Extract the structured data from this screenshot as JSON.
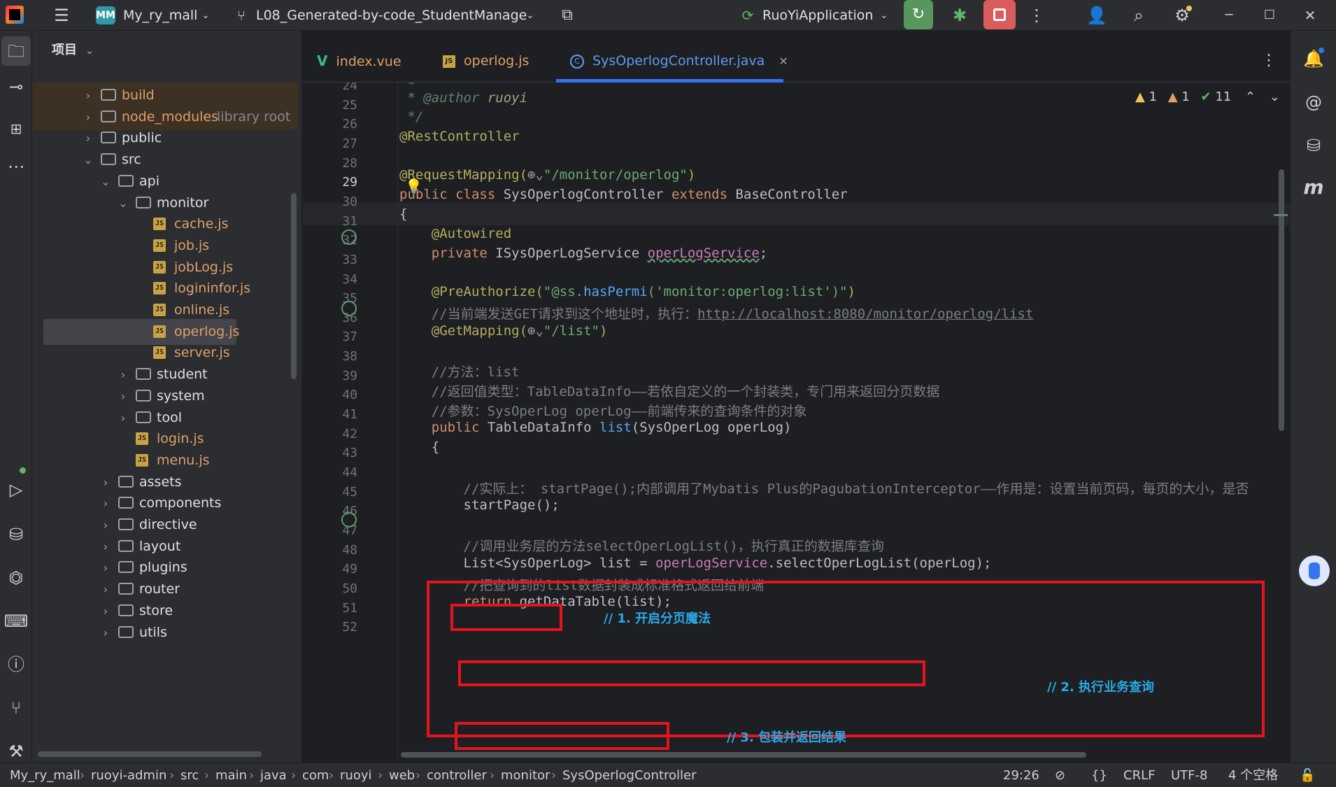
{
  "titlebar": {
    "project_badge": "MM",
    "project_name": "My_ry_mall",
    "branch_name": "L08_Generated-by-code_StudentManage",
    "run_config": "RuoYiApplication"
  },
  "project_panel": {
    "title": "项目",
    "items": [
      {
        "label": "build"
      },
      {
        "label": "node_modules",
        "hint": "library root"
      },
      {
        "label": "public"
      },
      {
        "label": "src"
      },
      {
        "label": "api"
      },
      {
        "label": "monitor"
      },
      {
        "label": "cache.js"
      },
      {
        "label": "job.js"
      },
      {
        "label": "jobLog.js"
      },
      {
        "label": "logininfor.js"
      },
      {
        "label": "online.js"
      },
      {
        "label": "operlog.js"
      },
      {
        "label": "server.js"
      },
      {
        "label": "student"
      },
      {
        "label": "system"
      },
      {
        "label": "tool"
      },
      {
        "label": "login.js"
      },
      {
        "label": "menu.js"
      },
      {
        "label": "assets"
      },
      {
        "label": "components"
      },
      {
        "label": "directive"
      },
      {
        "label": "layout"
      },
      {
        "label": "plugins"
      },
      {
        "label": "router"
      },
      {
        "label": "store"
      },
      {
        "label": "utils"
      }
    ]
  },
  "tabs": [
    {
      "label": "index.vue"
    },
    {
      "label": "operlog.js"
    },
    {
      "label": "SysOperlogController.java",
      "active": true
    }
  ],
  "inspections": {
    "warnings": "1",
    "weak_warnings": "1",
    "ok": "11"
  },
  "code": {
    "line_numbers": [
      "24",
      "25",
      "26",
      "27",
      "28",
      "29",
      "30",
      "31",
      "32",
      "33",
      "34",
      "35",
      "36",
      "37",
      "38",
      "39",
      "40",
      "41",
      "42",
      "43",
      "44",
      "45",
      "46",
      "47",
      "48",
      "49",
      "50",
      "51",
      "52"
    ],
    "l24": " *",
    "l25_tag": " * @author",
    "l25_val": " ruoyi",
    "l26": " */",
    "l27": "@RestController",
    "l29_ann": "@RequestMapping(",
    "l29_str": "\"/monitor/operlog\"",
    "l29_end": ")",
    "l30_a": "public class ",
    "l30_b": "SysOperlogController ",
    "l30_c": "extends ",
    "l30_d": "BaseController",
    "l31": "{",
    "l32": "    @Autowired",
    "l33_a": "    private ",
    "l33_b": "ISysOperLogService ",
    "l33_c": "operLogService",
    "l33_d": ";",
    "l35_a": "    @PreAuthorize(",
    "l35_b": "\"@ss.",
    "l35_c": "hasPermi",
    "l35_d": "('monitor:operlog:list')\"",
    "l35_e": ")",
    "l36_a": "    //当前端发送GET请求到这个地址时，执行：",
    "l36_b": "http://localhost:8080/monitor/operlog/list",
    "l37_a": "    @GetMapping(",
    "l37_b": "\"/list\"",
    "l37_c": ")",
    "l39": "    //方法：list",
    "l40": "    //返回值类型：TableDataInfo——若依自定义的一个封装类，专门用来返回分页数据",
    "l41": "    //参数：SysOperLog operLog——前端传来的查询条件的对象",
    "l42_a": "    public ",
    "l42_b": "TableDataInfo ",
    "l42_c": "list",
    "l42_d": "(SysOperLog operLog)",
    "l43": "    {",
    "l45": "        //实际上： startPage();内部调用了Mybatis Plus的PagubationInterceptor——作用是：设置当前页码，每页的大小，是否",
    "l46": "        startPage();",
    "l48": "        //调用业务层的方法selectOperLogList()，执行真正的数据库查询",
    "l49_a": "        List<SysOperLog> list = ",
    "l49_b": "operLogService",
    "l49_c": ".selectOperLogList(operLog);",
    "l50": "        //把查询到的list数据封装成标准格式返回给前端",
    "l51_a": "        return ",
    "l51_b": "getDataTable(list);"
  },
  "annotations": {
    "a1": "// 1. 开启分页魔法",
    "a2": "// 2. 执行业务查询",
    "a3": "// 3. 包装并返回结果"
  },
  "statusbar": {
    "crumbs": [
      "My_ry_mall",
      "ruoyi-admin",
      "src",
      "main",
      "java",
      "com",
      "ruoyi",
      "web",
      "controller",
      "monitor",
      "SysOperlogController"
    ],
    "position": "29:26",
    "line_sep": "CRLF",
    "encoding": "UTF-8",
    "indent": "4 个空格"
  },
  "colors": {
    "accent": "#3574f0",
    "annotation_box": "#e5131f",
    "annotation_text": "#2aa9e6"
  }
}
